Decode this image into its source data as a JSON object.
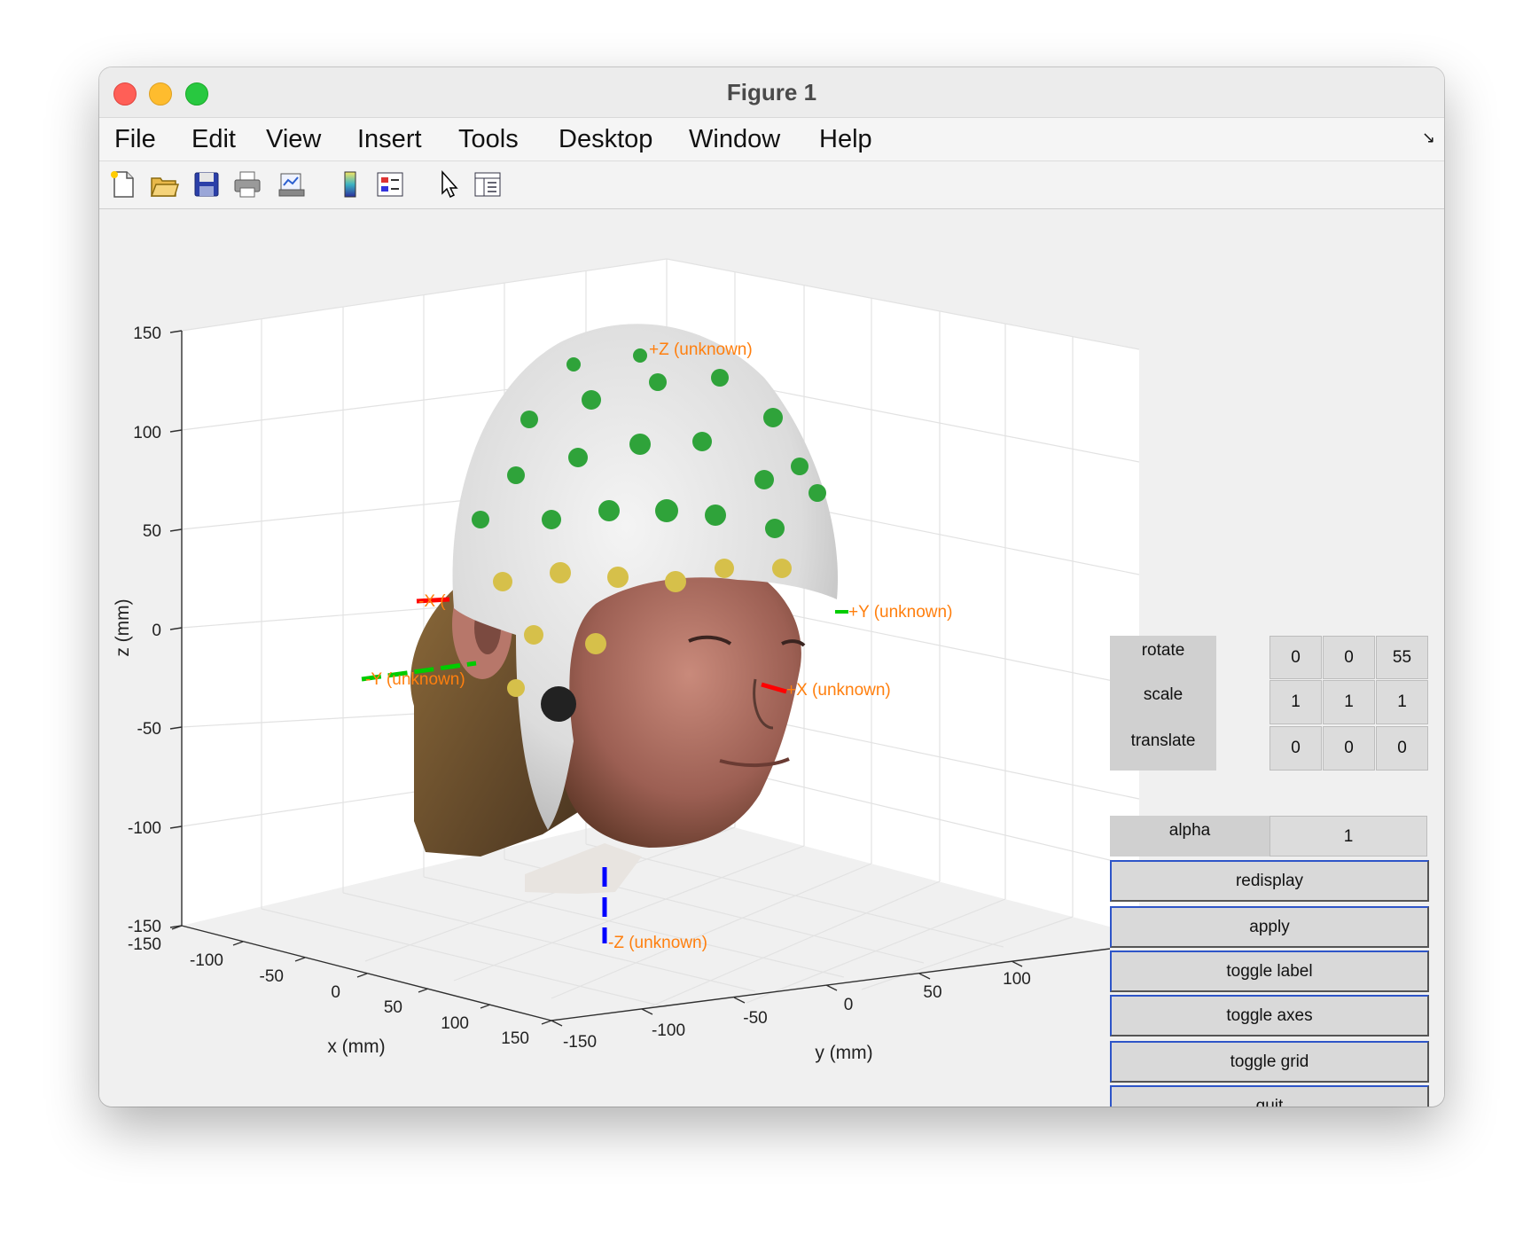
{
  "window": {
    "title": "Figure 1"
  },
  "menu": [
    "File",
    "Edit",
    "View",
    "Insert",
    "Tools",
    "Desktop",
    "Window",
    "Help"
  ],
  "toolbar": {
    "icons": [
      "new-figure-icon",
      "open-file-icon",
      "save-icon",
      "print-icon",
      "link-plot-icon",
      "colorbar-icon",
      "legend-icon",
      "pointer-icon",
      "property-editor-icon"
    ]
  },
  "axes": {
    "z_label": "z (mm)",
    "x_label": "x (mm)",
    "y_label": "y (mm)",
    "z_ticks": [
      "150",
      "100",
      "50",
      "0",
      "-50",
      "-100",
      "-150"
    ],
    "x_ticks": [
      "-150",
      "-100",
      "-50",
      "0",
      "50",
      "100",
      "150"
    ],
    "y_ticks": [
      "-150",
      "-100",
      "-50",
      "0",
      "50",
      "100"
    ],
    "grid": true
  },
  "markers": {
    "plus_x": "+X (unknown)",
    "minus_x": "-X (",
    "plus_y": "+Y (unknown)",
    "minus_y": "-Y (unknown)",
    "plus_z": "+Z (unknown)",
    "minus_z": "-Z (unknown)",
    "color_label": "#ff7f0e",
    "color_x": "#ff0000",
    "color_y": "#00cc00",
    "color_z": "#0000ff"
  },
  "controls": {
    "rotate_label": "rotate",
    "scale_label": "scale",
    "translate_label": "translate",
    "rotate": [
      "0",
      "0",
      "55"
    ],
    "scale": [
      "1",
      "1",
      "1"
    ],
    "translate": [
      "0",
      "0",
      "0"
    ],
    "alpha_label": "alpha",
    "alpha_value": "1",
    "buttons": {
      "redisplay": "redisplay",
      "apply": "apply",
      "toggle_label": "toggle label",
      "toggle_axes": "toggle axes",
      "toggle_grid": "toggle grid",
      "quit": "quit"
    }
  }
}
